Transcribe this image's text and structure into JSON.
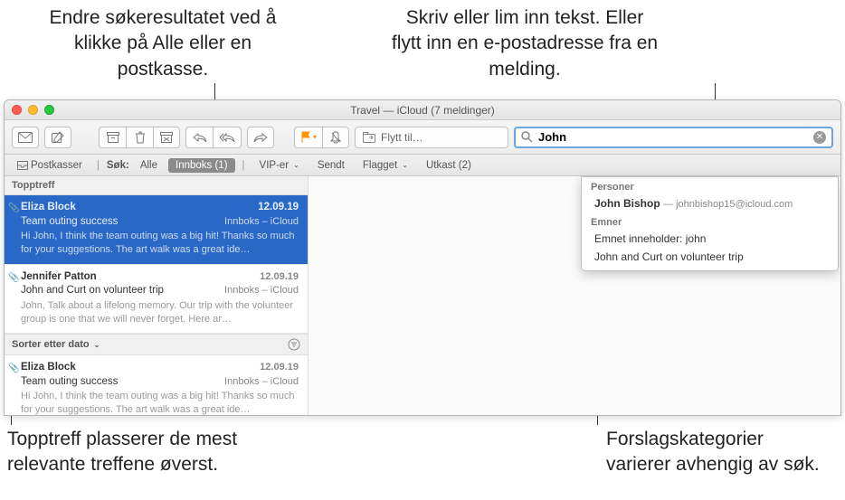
{
  "annotations": {
    "top_left": "Endre søkeresultatet ved å klikke på Alle eller en postkasse.",
    "top_right": "Skriv eller lim inn tekst. Eller flytt inn en e-postadresse fra en melding.",
    "bottom_left": "Topptreff plasserer de mest relevante treffene øverst.",
    "bottom_right": "Forslagskategorier varierer avhengig av søk."
  },
  "window": {
    "title": "Travel — iCloud (7 meldinger)"
  },
  "toolbar": {
    "move_label": "Flytt til…"
  },
  "search": {
    "value": "John"
  },
  "favbar": {
    "mailboxes": "Postkasser",
    "search_label": "Søk:",
    "all": "Alle",
    "inbox": "Innboks (1)",
    "vip": "VIP-er",
    "sent": "Sendt",
    "flagged": "Flagget",
    "drafts": "Utkast (2)"
  },
  "sections": {
    "tophits": "Topptreff",
    "sort_label": "Sorter etter dato"
  },
  "messages": [
    {
      "sender": "Eliza Block",
      "date": "12.09.19",
      "subject": "Team outing success",
      "mailbox": "Innboks – iCloud",
      "preview": "Hi John, I think the team outing was a big hit! Thanks so much for your suggestions. The art walk was a great ide…",
      "selected": true,
      "attachment": true
    },
    {
      "sender": "Jennifer Patton",
      "date": "12.09.19",
      "subject": "John and Curt on volunteer trip",
      "mailbox": "Innboks – iCloud",
      "preview": "John, Talk about a lifelong memory. Our trip with the volunteer group is one that we will never forget. Here ar…",
      "selected": false,
      "attachment": true
    }
  ],
  "sorted_messages": [
    {
      "sender": "Eliza Block",
      "date": "12.09.19",
      "subject": "Team outing success",
      "mailbox": "Innboks – iCloud",
      "preview": "Hi John, I think the team outing was a big hit! Thanks so much for your suggestions. The art walk was a great ide…",
      "attachment": true
    }
  ],
  "suggestions": {
    "cat_people": "Personer",
    "person_name": "John Bishop",
    "person_email": "johnbishop15@icloud.com",
    "cat_subjects": "Emner",
    "subj1": "Emnet inneholder: john",
    "subj2": "John and Curt on volunteer trip"
  }
}
